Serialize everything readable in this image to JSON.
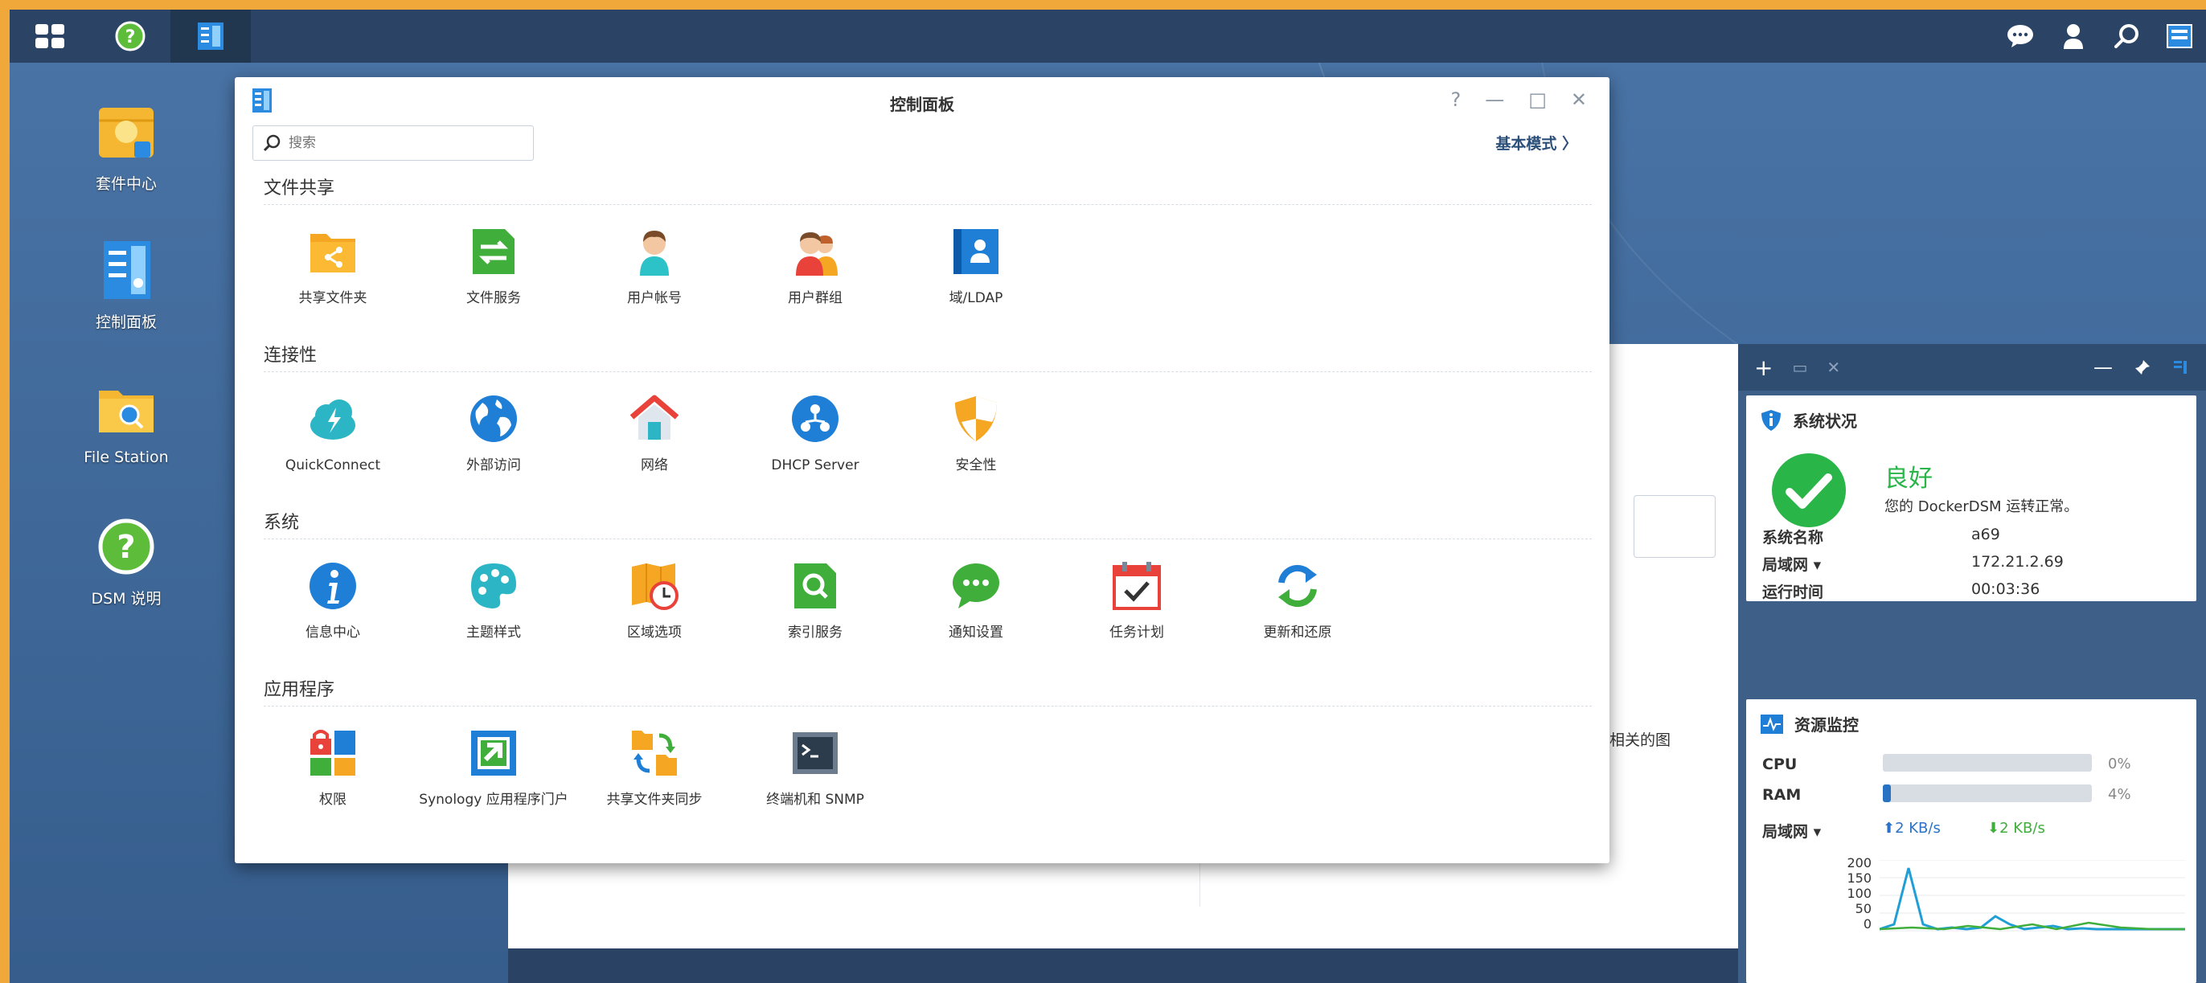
{
  "desktop": {
    "icons": [
      {
        "label": "套件中心"
      },
      {
        "label": "控制面板"
      },
      {
        "label": "File Station"
      },
      {
        "label": "DSM 说明"
      }
    ]
  },
  "control_panel": {
    "title": "控制面板",
    "search_placeholder": "搜索",
    "mode_link": "基本模式 〉",
    "window_controls": {
      "help": "?",
      "minimize": "—",
      "maximize": "□",
      "close": "✕"
    },
    "sections": [
      {
        "title": "文件共享",
        "items": [
          "共享文件夹",
          "文件服务",
          "用户帐号",
          "用户群组",
          "域/LDAP"
        ]
      },
      {
        "title": "连接性",
        "items": [
          "QuickConnect",
          "外部访问",
          "网络",
          "DHCP Server",
          "安全性"
        ]
      },
      {
        "title": "系统",
        "items": [
          "信息中心",
          "主题样式",
          "区域选项",
          "索引服务",
          "通知设置",
          "任务计划",
          "更新和还原"
        ]
      },
      {
        "title": "应用程序",
        "items": [
          "权限",
          "Synology 应用程序门户",
          "共享文件夹同步",
          "终端机和 SNMP"
        ]
      }
    ]
  },
  "background_window": {
    "text_fragment": "相关的图"
  },
  "widget": {
    "status": {
      "title": "系统状况",
      "state": "良好",
      "message": "您的 DockerDSM 运转正常。",
      "rows": [
        {
          "key": "系统名称",
          "value": "a69"
        },
        {
          "key": "局域网 ▾",
          "value": "172.21.2.69"
        },
        {
          "key": "运行时间",
          "value": "00:03:36"
        }
      ]
    },
    "resource": {
      "title": "资源监控",
      "cpu_label": "CPU",
      "cpu_pct": "0%",
      "cpu_value": 0,
      "ram_label": "RAM",
      "ram_pct": "4%",
      "ram_value": 4,
      "net_label": "局域网 ▾",
      "upload": "⬆2 KB/s",
      "download": "⬇2 KB/s",
      "chart_ticks": [
        "200",
        "150",
        "100",
        "50",
        "0"
      ]
    }
  },
  "colors": {
    "accent": "#2b72c8",
    "ok_green": "#29b548",
    "taskbar": "#2b4466"
  }
}
